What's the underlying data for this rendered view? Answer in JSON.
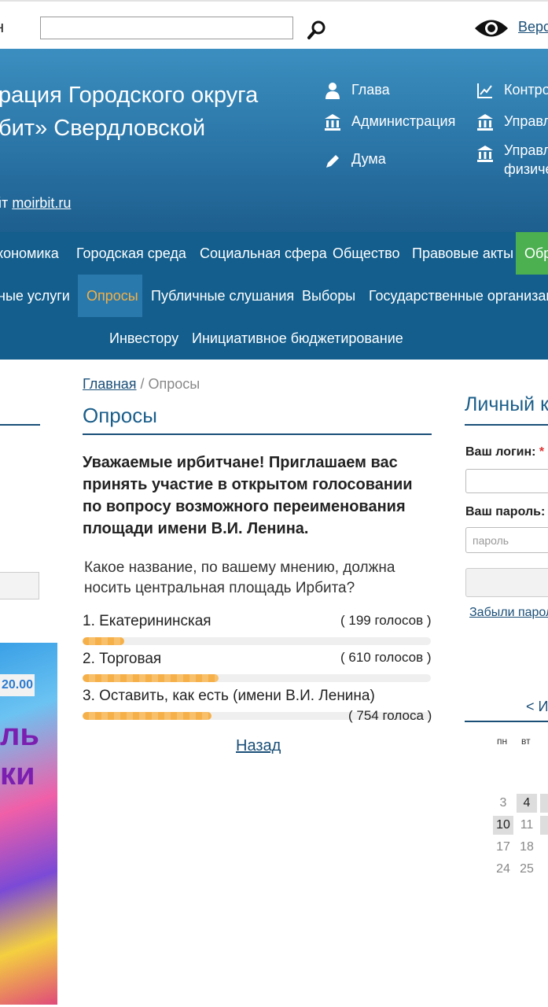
{
  "topbar": {
    "fragment": "н",
    "version_link": "Верс"
  },
  "header": {
    "title": "рация Городского округа\nбит» Свердловской",
    "moirbit_prefix": "йт ",
    "moirbit_link": "moirbit.ru",
    "links": {
      "glava": "Глава",
      "admin": "Администрация",
      "duma": "Дума",
      "kontrol": "Контро",
      "uprav1": "Управл",
      "uprav2": "Управл",
      "uprav2_line2": "физиче"
    }
  },
  "nav": {
    "row1": [
      "кономика",
      "Городская среда",
      "Социальная сфера",
      "Общество",
      "Правовые акты",
      "Обр"
    ],
    "row2": [
      "ные услуги",
      "Опросы",
      "Публичные слушания",
      "Выборы",
      "Государственные организац"
    ],
    "row3": [
      "Инвестору",
      "Инициативное бюджетирование"
    ]
  },
  "breadcrumb": {
    "home": "Главная",
    "sep": " / ",
    "current": "Опросы"
  },
  "page_title": "Опросы",
  "poll": {
    "heading": "Уважаемые ирбитчане! Приглашаем вас принять участие в открытом голосовании по вопросу возможного переименования площади имени В.И. Ленина.",
    "question": "Какое название, по вашему мнению, должна носить центральная площадь Ирбита?",
    "options": [
      {
        "label": "1. Екатерининская",
        "count": "( 199 голосов )",
        "fill": 0.12
      },
      {
        "label": "2. Торговая",
        "count": "( 610 голосов )",
        "fill": 0.39
      },
      {
        "label": "3. Оставить, как есть (имени В.И. Ленина)",
        "count": "( 754 голоса )",
        "fill": 0.37
      }
    ],
    "back": "Назад"
  },
  "banner": {
    "time": "20.00",
    "line1": "ль",
    "line2": "ки"
  },
  "lk": {
    "title": "Личный к",
    "login_label": "Ваш логин:",
    "pass_label": "Ваш пароль:",
    "required_mark": "*",
    "pass_placeholder": "пароль",
    "forgot": "Забыли парол"
  },
  "calendar": {
    "nav": "<  И",
    "dow": [
      "пн",
      "вт"
    ],
    "weeks": [
      [
        "3",
        "4"
      ],
      [
        "10",
        "11"
      ],
      [
        "17",
        "18"
      ],
      [
        "24",
        "25"
      ]
    ]
  }
}
